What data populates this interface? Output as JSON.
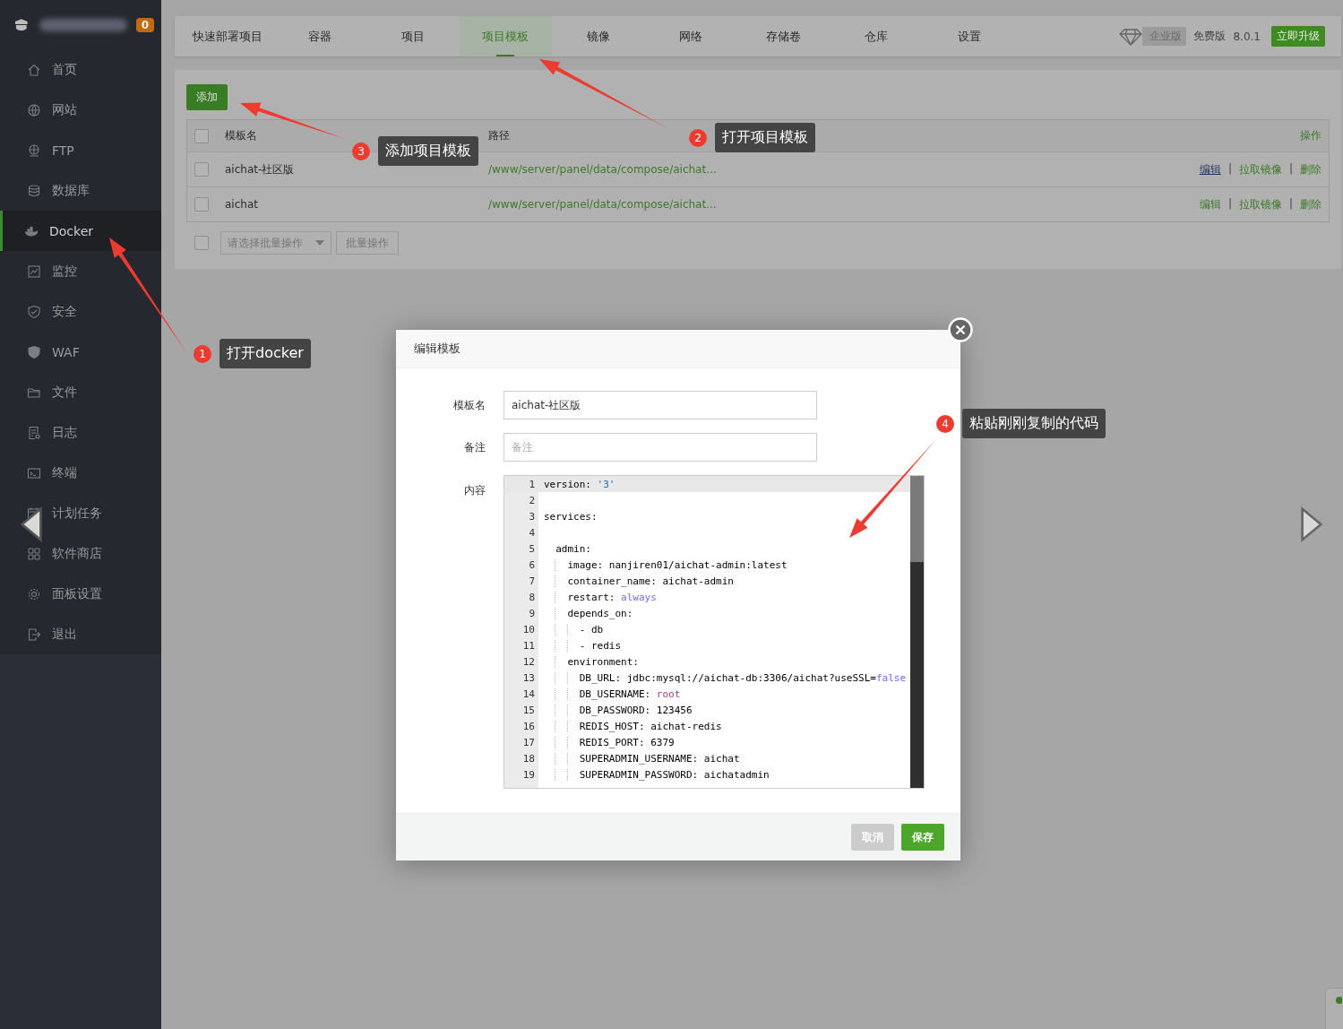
{
  "sidebar": {
    "badge": "0",
    "items": [
      {
        "label": "首页",
        "kind": "home",
        "selected": false
      },
      {
        "label": "网站",
        "kind": "globe",
        "selected": false
      },
      {
        "label": "FTP",
        "kind": "ftp",
        "selected": false
      },
      {
        "label": "数据库",
        "kind": "database",
        "selected": false
      },
      {
        "label": "Docker",
        "kind": "docker",
        "selected": true
      },
      {
        "label": "监控",
        "kind": "monitor",
        "selected": false
      },
      {
        "label": "安全",
        "kind": "shield",
        "selected": false
      },
      {
        "label": "WAF",
        "kind": "waf",
        "selected": false
      },
      {
        "label": "文件",
        "kind": "folder",
        "selected": false
      },
      {
        "label": "日志",
        "kind": "log",
        "selected": false
      },
      {
        "label": "终端",
        "kind": "terminal",
        "selected": false
      },
      {
        "label": "计划任务",
        "kind": "calendar",
        "selected": false
      },
      {
        "label": "软件商店",
        "kind": "apps",
        "selected": false
      },
      {
        "label": "面板设置",
        "kind": "gear",
        "selected": false
      },
      {
        "label": "退出",
        "kind": "exit",
        "selected": false
      }
    ]
  },
  "tabs": [
    {
      "label": "快速部署项目",
      "selected": false
    },
    {
      "label": "容器",
      "selected": false
    },
    {
      "label": "项目",
      "selected": false
    },
    {
      "label": "项目模板",
      "selected": true
    },
    {
      "label": "镜像",
      "selected": false
    },
    {
      "label": "网络",
      "selected": false
    },
    {
      "label": "存储卷",
      "selected": false
    },
    {
      "label": "仓库",
      "selected": false
    },
    {
      "label": "设置",
      "selected": false
    }
  ],
  "edition": {
    "tag": "企业版",
    "plan": "免费版",
    "version": "8.0.1",
    "upgrade": "立即升级"
  },
  "add_button": "添加",
  "table": {
    "all_checked": false,
    "separator": "|",
    "columns": [
      "模板名",
      "路径",
      "操作"
    ],
    "rows": [
      {
        "checked": false,
        "name": "aichat-社区版",
        "path": "/www/server/panel/data/compose/aichat...",
        "actions": [
          {
            "label": "编辑",
            "hovered": true
          },
          {
            "label": "拉取镜像",
            "hovered": false
          },
          {
            "label": "删除",
            "hovered": false
          }
        ]
      },
      {
        "checked": false,
        "name": "aichat",
        "path": "/www/server/panel/data/compose/aichat...",
        "actions": [
          {
            "label": "编辑",
            "hovered": false
          },
          {
            "label": "拉取镜像",
            "hovered": false
          },
          {
            "label": "删除",
            "hovered": false
          }
        ]
      }
    ]
  },
  "bulk": {
    "checked": false,
    "placeholder": "请选择批量操作",
    "button": "批量操作"
  },
  "dialog": {
    "title": "编辑模板",
    "fields": [
      {
        "label": "模板名",
        "value": "aichat-社区版"
      },
      {
        "label": "备注",
        "placeholder": "备注"
      }
    ],
    "content_label": "内容",
    "code": [
      {
        "number": "1",
        "parts": [
          {
            "text": "version: ",
            "kind": "plain"
          },
          {
            "text": "'3'",
            "kind": "string"
          }
        ]
      },
      {
        "number": "2"
      },
      {
        "number": "3",
        "parts": [
          {
            "text": "services:",
            "kind": "plain"
          }
        ]
      },
      {
        "number": "4"
      },
      {
        "number": "5",
        "parts": [
          {
            "text": "  admin:",
            "kind": "plain"
          }
        ]
      },
      {
        "number": "6",
        "parts": [
          {
            "text": "    image: nanjiren01/aichat-admin:latest",
            "kind": "plain"
          }
        ]
      },
      {
        "number": "7",
        "parts": [
          {
            "text": "    container_name: aichat-admin",
            "kind": "plain"
          }
        ]
      },
      {
        "number": "8",
        "parts": [
          {
            "text": "    restart: ",
            "kind": "plain"
          },
          {
            "text": "always",
            "kind": "atom"
          }
        ]
      },
      {
        "number": "9",
        "parts": [
          {
            "text": "    depends_on:",
            "kind": "plain"
          }
        ]
      },
      {
        "number": "10",
        "parts": [
          {
            "text": "      - db",
            "kind": "plain"
          }
        ]
      },
      {
        "number": "11",
        "parts": [
          {
            "text": "      - redis",
            "kind": "plain"
          }
        ]
      },
      {
        "number": "12",
        "parts": [
          {
            "text": "    environment:",
            "kind": "plain"
          }
        ]
      },
      {
        "number": "13",
        "parts": [
          {
            "text": "      DB_URL: jdbc:mysql://aichat-db:3306/aichat?useSSL=",
            "kind": "plain"
          },
          {
            "text": "false",
            "kind": "atom"
          }
        ]
      },
      {
        "number": "14",
        "parts": [
          {
            "text": "      DB_USERNAME: ",
            "kind": "plain"
          },
          {
            "text": "root",
            "kind": "keyword"
          }
        ]
      },
      {
        "number": "15",
        "parts": [
          {
            "text": "      DB_PASSWORD: 123456",
            "kind": "plain"
          }
        ]
      },
      {
        "number": "16",
        "parts": [
          {
            "text": "      REDIS_HOST: aichat-redis",
            "kind": "plain"
          }
        ]
      },
      {
        "number": "17",
        "parts": [
          {
            "text": "      REDIS_PORT: 6379",
            "kind": "plain"
          }
        ]
      },
      {
        "number": "18",
        "parts": [
          {
            "text": "      SUPERADMIN_USERNAME: aichat",
            "kind": "plain"
          }
        ]
      },
      {
        "number": "19",
        "parts": [
          {
            "text": "      SUPERADMIN_PASSWORD: aichatadmin",
            "kind": "plain"
          }
        ]
      }
    ],
    "buttons": [
      {
        "label": "取消",
        "kind": "cancel"
      },
      {
        "label": "保存",
        "kind": "primary"
      }
    ]
  },
  "annotations": [
    {
      "number": "1",
      "text": "打开docker"
    },
    {
      "number": "2",
      "text": "打开项目模板"
    },
    {
      "number": "3",
      "text": "添加项目模板"
    },
    {
      "number": "4",
      "text": "粘贴刚刚复制的代码"
    }
  ]
}
